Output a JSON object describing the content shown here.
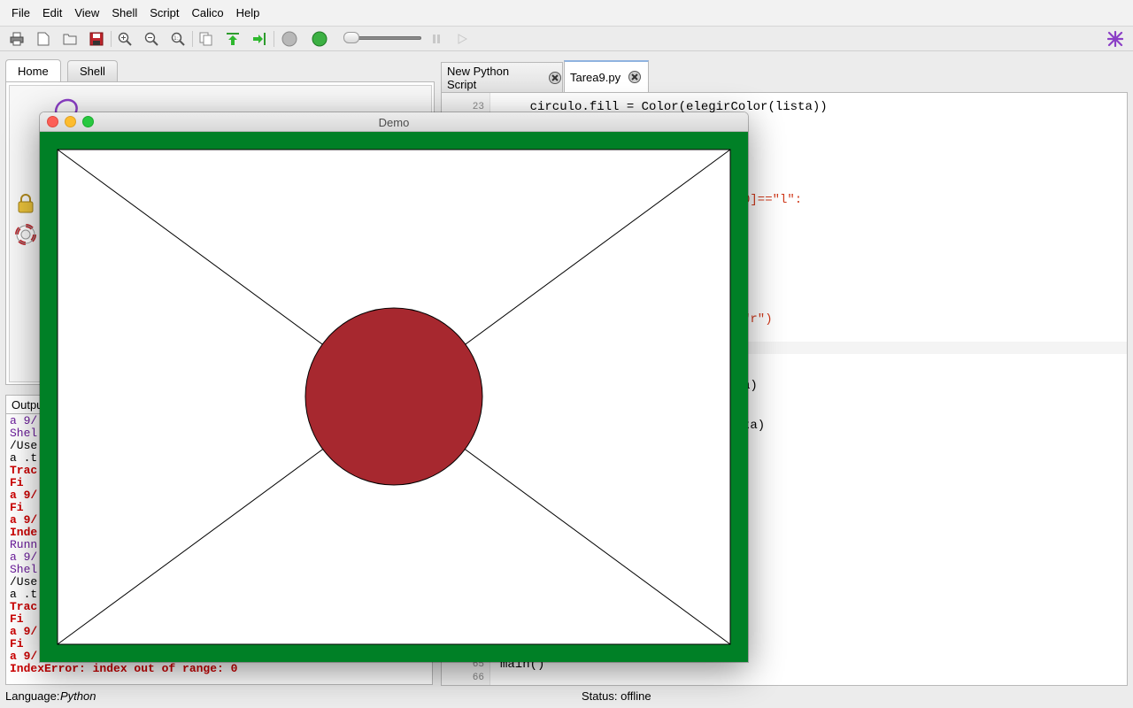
{
  "menu": [
    "File",
    "Edit",
    "View",
    "Shell",
    "Script",
    "Calico",
    "Help"
  ],
  "toolbar": {
    "icons": [
      "print-icon",
      "new-file-icon",
      "open-folder-icon",
      "save-icon",
      "zoom-in-icon",
      "zoom-out-icon",
      "zoom-reset-icon",
      "copy-icon",
      "upload-icon",
      "run-arrow-icon",
      "stop-circle-icon",
      "go-circle-icon",
      "speed-slider",
      "pause-icon",
      "play-icon",
      "calico-logo-icon"
    ],
    "speed_fraction": 0.05
  },
  "left_tabs": [
    {
      "label": "Home",
      "active": true
    },
    {
      "label": "Shell",
      "active": false
    }
  ],
  "output": {
    "tab_label": "Output",
    "lines": [
      {
        "text": "a 9/",
        "color": "#6a1b9a"
      },
      {
        "text": "Shel",
        "color": "#6a1b9a"
      },
      {
        "text": "/Use",
        "color": "#000000"
      },
      {
        "text": "a .t",
        "color": "#000000"
      },
      {
        "text": "Trac",
        "color": "#cc0000"
      },
      {
        "text": "  Fi",
        "color": "#cc0000"
      },
      {
        "text": "a 9/",
        "color": "#cc0000"
      },
      {
        "text": "  Fi",
        "color": "#cc0000"
      },
      {
        "text": "a 9/",
        "color": "#cc0000"
      },
      {
        "text": "Inde",
        "color": "#cc0000"
      },
      {
        "text": "Runn",
        "color": "#6a1b9a"
      },
      {
        "text": "a 9/",
        "color": "#6a1b9a"
      },
      {
        "text": "Shel",
        "color": "#6a1b9a"
      },
      {
        "text": "/Use",
        "color": "#000000"
      },
      {
        "text": "a .t",
        "color": "#000000"
      },
      {
        "text": "Trac",
        "color": "#cc0000"
      },
      {
        "text": "  Fi",
        "color": "#cc0000"
      },
      {
        "text": "a 9/",
        "color": "#cc0000"
      },
      {
        "text": "  Fi",
        "color": "#cc0000"
      },
      {
        "text": "a 9/",
        "color": "#cc0000"
      },
      {
        "text": "IndexError: index out of range: 0",
        "color": "#cc0000"
      }
    ]
  },
  "editor_tabs": [
    {
      "label": "New Python Script",
      "active": false
    },
    {
      "label": "Tarea9.py",
      "active": true
    }
  ],
  "editor": {
    "lines": [
      {
        "num": "23",
        "code": "    circulo.fill = Color(elegirColor(lista))"
      },
      {
        "num": "65",
        "code": "main()"
      },
      {
        "num": "66",
        "code": ""
      }
    ],
    "fragments": [
      {
        "text": "0]==\"l\":"
      },
      {
        "text": "\"r\")"
      },
      {
        "text": "a)"
      },
      {
        "text": "ta)"
      },
      {
        "text": ")"
      }
    ]
  },
  "status": {
    "language_label": "Language:",
    "language": "Python",
    "status_label": "Status:",
    "status": "offline"
  },
  "demo": {
    "title": "Demo",
    "border_color": "#008026",
    "circle_color": "#a7282f",
    "background_color": "#ffffff"
  }
}
